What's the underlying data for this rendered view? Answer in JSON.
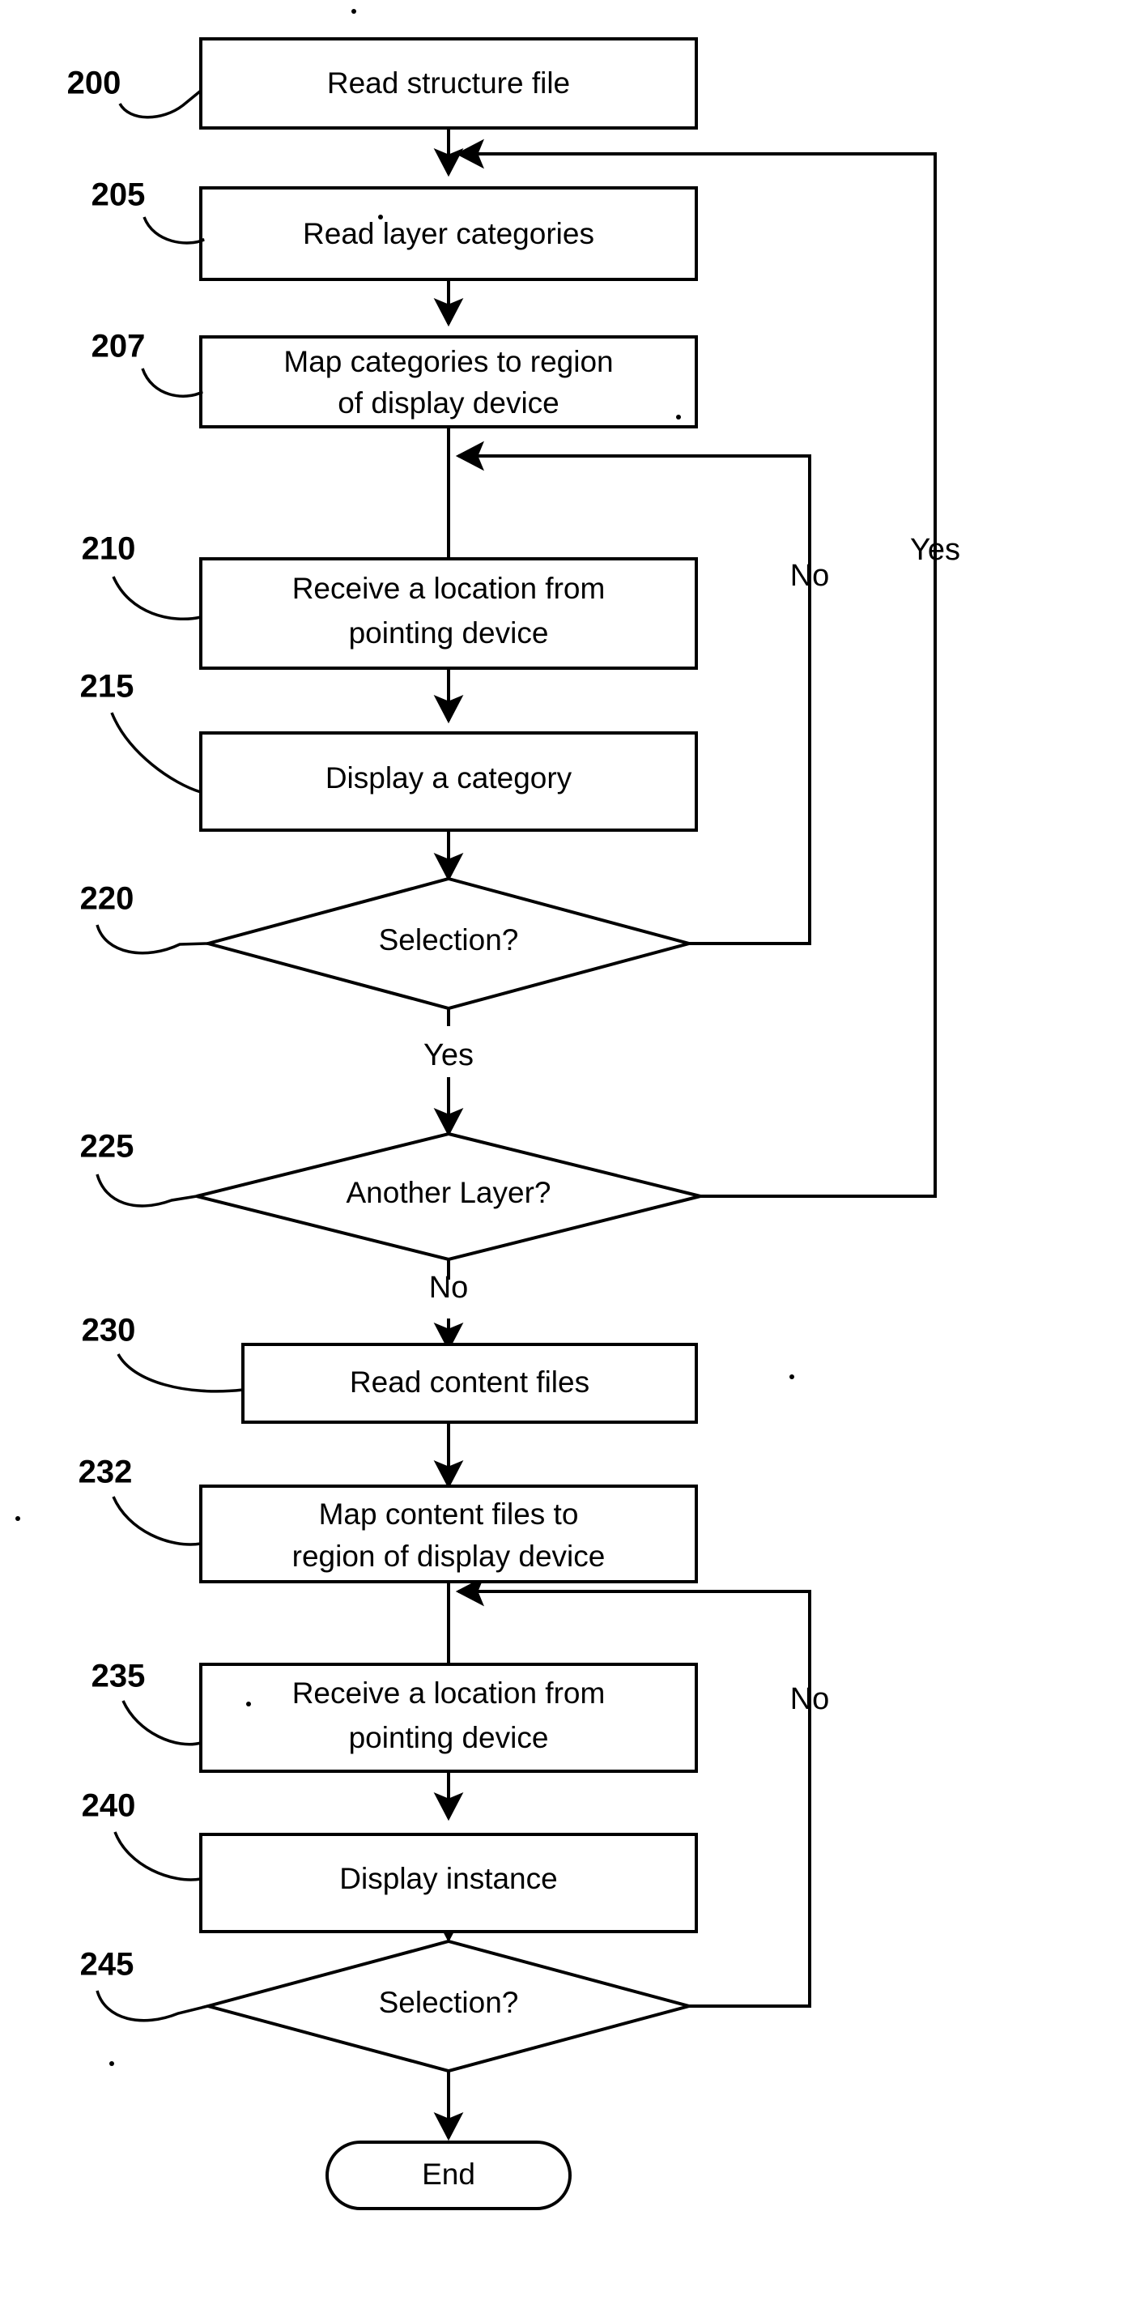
{
  "figure": {
    "kind": "patent-flowchart",
    "background_color": "#ffffff",
    "ink_color": "#000000"
  },
  "nodes": [
    {
      "id": "200",
      "ref": "200",
      "shape": "process",
      "label": "Read structure file"
    },
    {
      "id": "205",
      "ref": "205",
      "shape": "process",
      "label": "Read layer categories"
    },
    {
      "id": "207",
      "ref": "207",
      "shape": "process",
      "label_line1": "Map categories to region",
      "label_line2": "of display device"
    },
    {
      "id": "210",
      "ref": "210",
      "shape": "process",
      "label_line1": "Receive a location from",
      "label_line2": "pointing device"
    },
    {
      "id": "215",
      "ref": "215",
      "shape": "process",
      "label": "Display a category"
    },
    {
      "id": "220",
      "ref": "220",
      "shape": "decision",
      "label": "Selection?"
    },
    {
      "id": "225",
      "ref": "225",
      "shape": "decision",
      "label": "Another Layer?"
    },
    {
      "id": "230",
      "ref": "230",
      "shape": "process",
      "label": "Read content files"
    },
    {
      "id": "232",
      "ref": "232",
      "shape": "process",
      "label_line1": "Map content files to",
      "label_line2": "region of display device"
    },
    {
      "id": "235",
      "ref": "235",
      "shape": "process",
      "label_line1": "Receive a location from",
      "label_line2": "pointing device"
    },
    {
      "id": "240",
      "ref": "240",
      "shape": "process",
      "label": "Display instance"
    },
    {
      "id": "245",
      "ref": "245",
      "shape": "decision",
      "label": "Selection?"
    },
    {
      "id": "end",
      "ref": "",
      "shape": "terminator",
      "label": "End"
    }
  ],
  "edge_labels": {
    "selection_220_no": "No",
    "selection_220_yes": "Yes",
    "another_layer_225_yes": "Yes",
    "another_layer_225_no": "No",
    "selection_245_no": "No"
  },
  "flow": [
    {
      "from": "200",
      "to": "205",
      "label": ""
    },
    {
      "from": "205",
      "to": "207",
      "label": ""
    },
    {
      "from": "207",
      "to": "210",
      "label": ""
    },
    {
      "from": "210",
      "to": "215",
      "label": ""
    },
    {
      "from": "215",
      "to": "220",
      "label": ""
    },
    {
      "from": "220",
      "to": "210",
      "label": "No"
    },
    {
      "from": "220",
      "to": "225",
      "label": "Yes"
    },
    {
      "from": "225",
      "to": "205",
      "label": "Yes"
    },
    {
      "from": "225",
      "to": "230",
      "label": "No"
    },
    {
      "from": "230",
      "to": "232",
      "label": ""
    },
    {
      "from": "232",
      "to": "235",
      "label": ""
    },
    {
      "from": "235",
      "to": "240",
      "label": ""
    },
    {
      "from": "240",
      "to": "245",
      "label": ""
    },
    {
      "from": "245",
      "to": "235",
      "label": "No"
    },
    {
      "from": "245",
      "to": "end",
      "label": ""
    }
  ]
}
